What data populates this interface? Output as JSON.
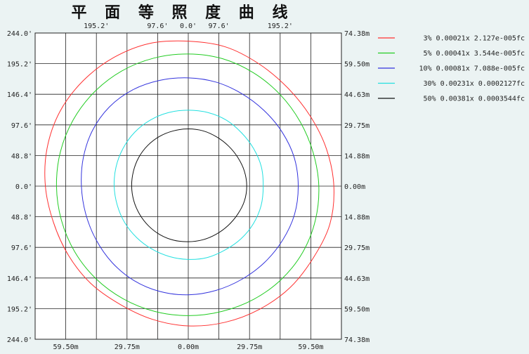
{
  "title": "平 面 等 照 度 曲 线",
  "colors": {
    "background": "#ebf3f3",
    "plot_background": "#ffffff",
    "grid": "#222222"
  },
  "chart_data": {
    "type": "line",
    "title": "平 面 等 照 度 曲 线",
    "grid": true,
    "legend_position": "right",
    "x_top_labels": [
      "195.2'",
      "97.6'",
      "0.0'",
      "97.6'",
      "195.2'"
    ],
    "x_bottom_labels": [
      "59.50m",
      "29.75m",
      "0.00m",
      "29.75m",
      "59.50m"
    ],
    "y_left_labels": [
      "244.0'",
      "195.2'",
      "146.4'",
      "97.6'",
      "48.8'",
      "0.0'",
      "48.8'",
      "97.6'",
      "146.4'",
      "195.2'",
      "244.0'"
    ],
    "y_right_labels": [
      "74.38m",
      "59.50m",
      "44.63m",
      "29.75m",
      "14.88m",
      "0.00m",
      "14.88m",
      "29.75m",
      "44.63m",
      "59.50m",
      "74.38m"
    ],
    "xlim": [
      -74.38,
      74.38
    ],
    "ylim": [
      -74.38,
      74.38
    ],
    "series": [
      {
        "name": "3% 0.00021x 2.127e-005fc",
        "color": "#ff3030",
        "r": [
          70.4,
          70.0,
          68.6,
          67.9,
          68.3,
          69.5,
          70.7,
          71.2,
          70.0,
          69.8,
          69.1,
          68.5,
          67.9,
          67.0,
          66.3,
          66.9,
          67.2,
          67.8,
          69.4,
          71.0,
          72.1,
          72.3,
          72.2,
          71.8
        ]
      },
      {
        "name": "5% 0.00041x 3.544e-005fc",
        "color": "#22cc22",
        "r": [
          64.2,
          64.1,
          63.5,
          63.0,
          62.7,
          62.8,
          63.4,
          63.9,
          64.2,
          64.0,
          63.5,
          63.0,
          62.9,
          63.0,
          63.2,
          63.5,
          63.7,
          63.8,
          64.0,
          64.3,
          64.5,
          64.6,
          64.6,
          64.4
        ]
      },
      {
        "name": "10% 0.00081x 7.088e-005fc",
        "color": "#3333dd",
        "r": [
          52.6,
          52.3,
          51.9,
          52.0,
          52.6,
          53.3,
          53.4,
          53.4,
          52.8,
          52.4,
          52.2,
          52.4,
          52.8,
          53.0,
          52.9,
          52.4,
          51.8,
          51.6,
          51.9,
          52.8,
          53.8,
          54.3,
          54.0,
          53.2
        ]
      },
      {
        "name": "30% 0.00231x 0.0002127fc",
        "color": "#22e0e0",
        "r": [
          36.9,
          37.0,
          37.0,
          36.6,
          36.6,
          36.7,
          36.4,
          36.6,
          36.5,
          36.2,
          35.8,
          35.9,
          35.6,
          35.4,
          35.3,
          35.4,
          35.6,
          35.7,
          36.0,
          36.3,
          36.6,
          36.9,
          37.0,
          37.0
        ]
      },
      {
        "name": "50% 0.00381x 0.0003544fc",
        "color": "#111111",
        "r": [
          27.8,
          27.8,
          27.6,
          27.6,
          27.8,
          28.2,
          28.4,
          28.2,
          27.6,
          27.2,
          27.0,
          27.0,
          27.0,
          27.2,
          27.3,
          27.3,
          27.3,
          27.4,
          27.5,
          27.6,
          27.8,
          27.9,
          27.9,
          27.8
        ]
      }
    ]
  }
}
